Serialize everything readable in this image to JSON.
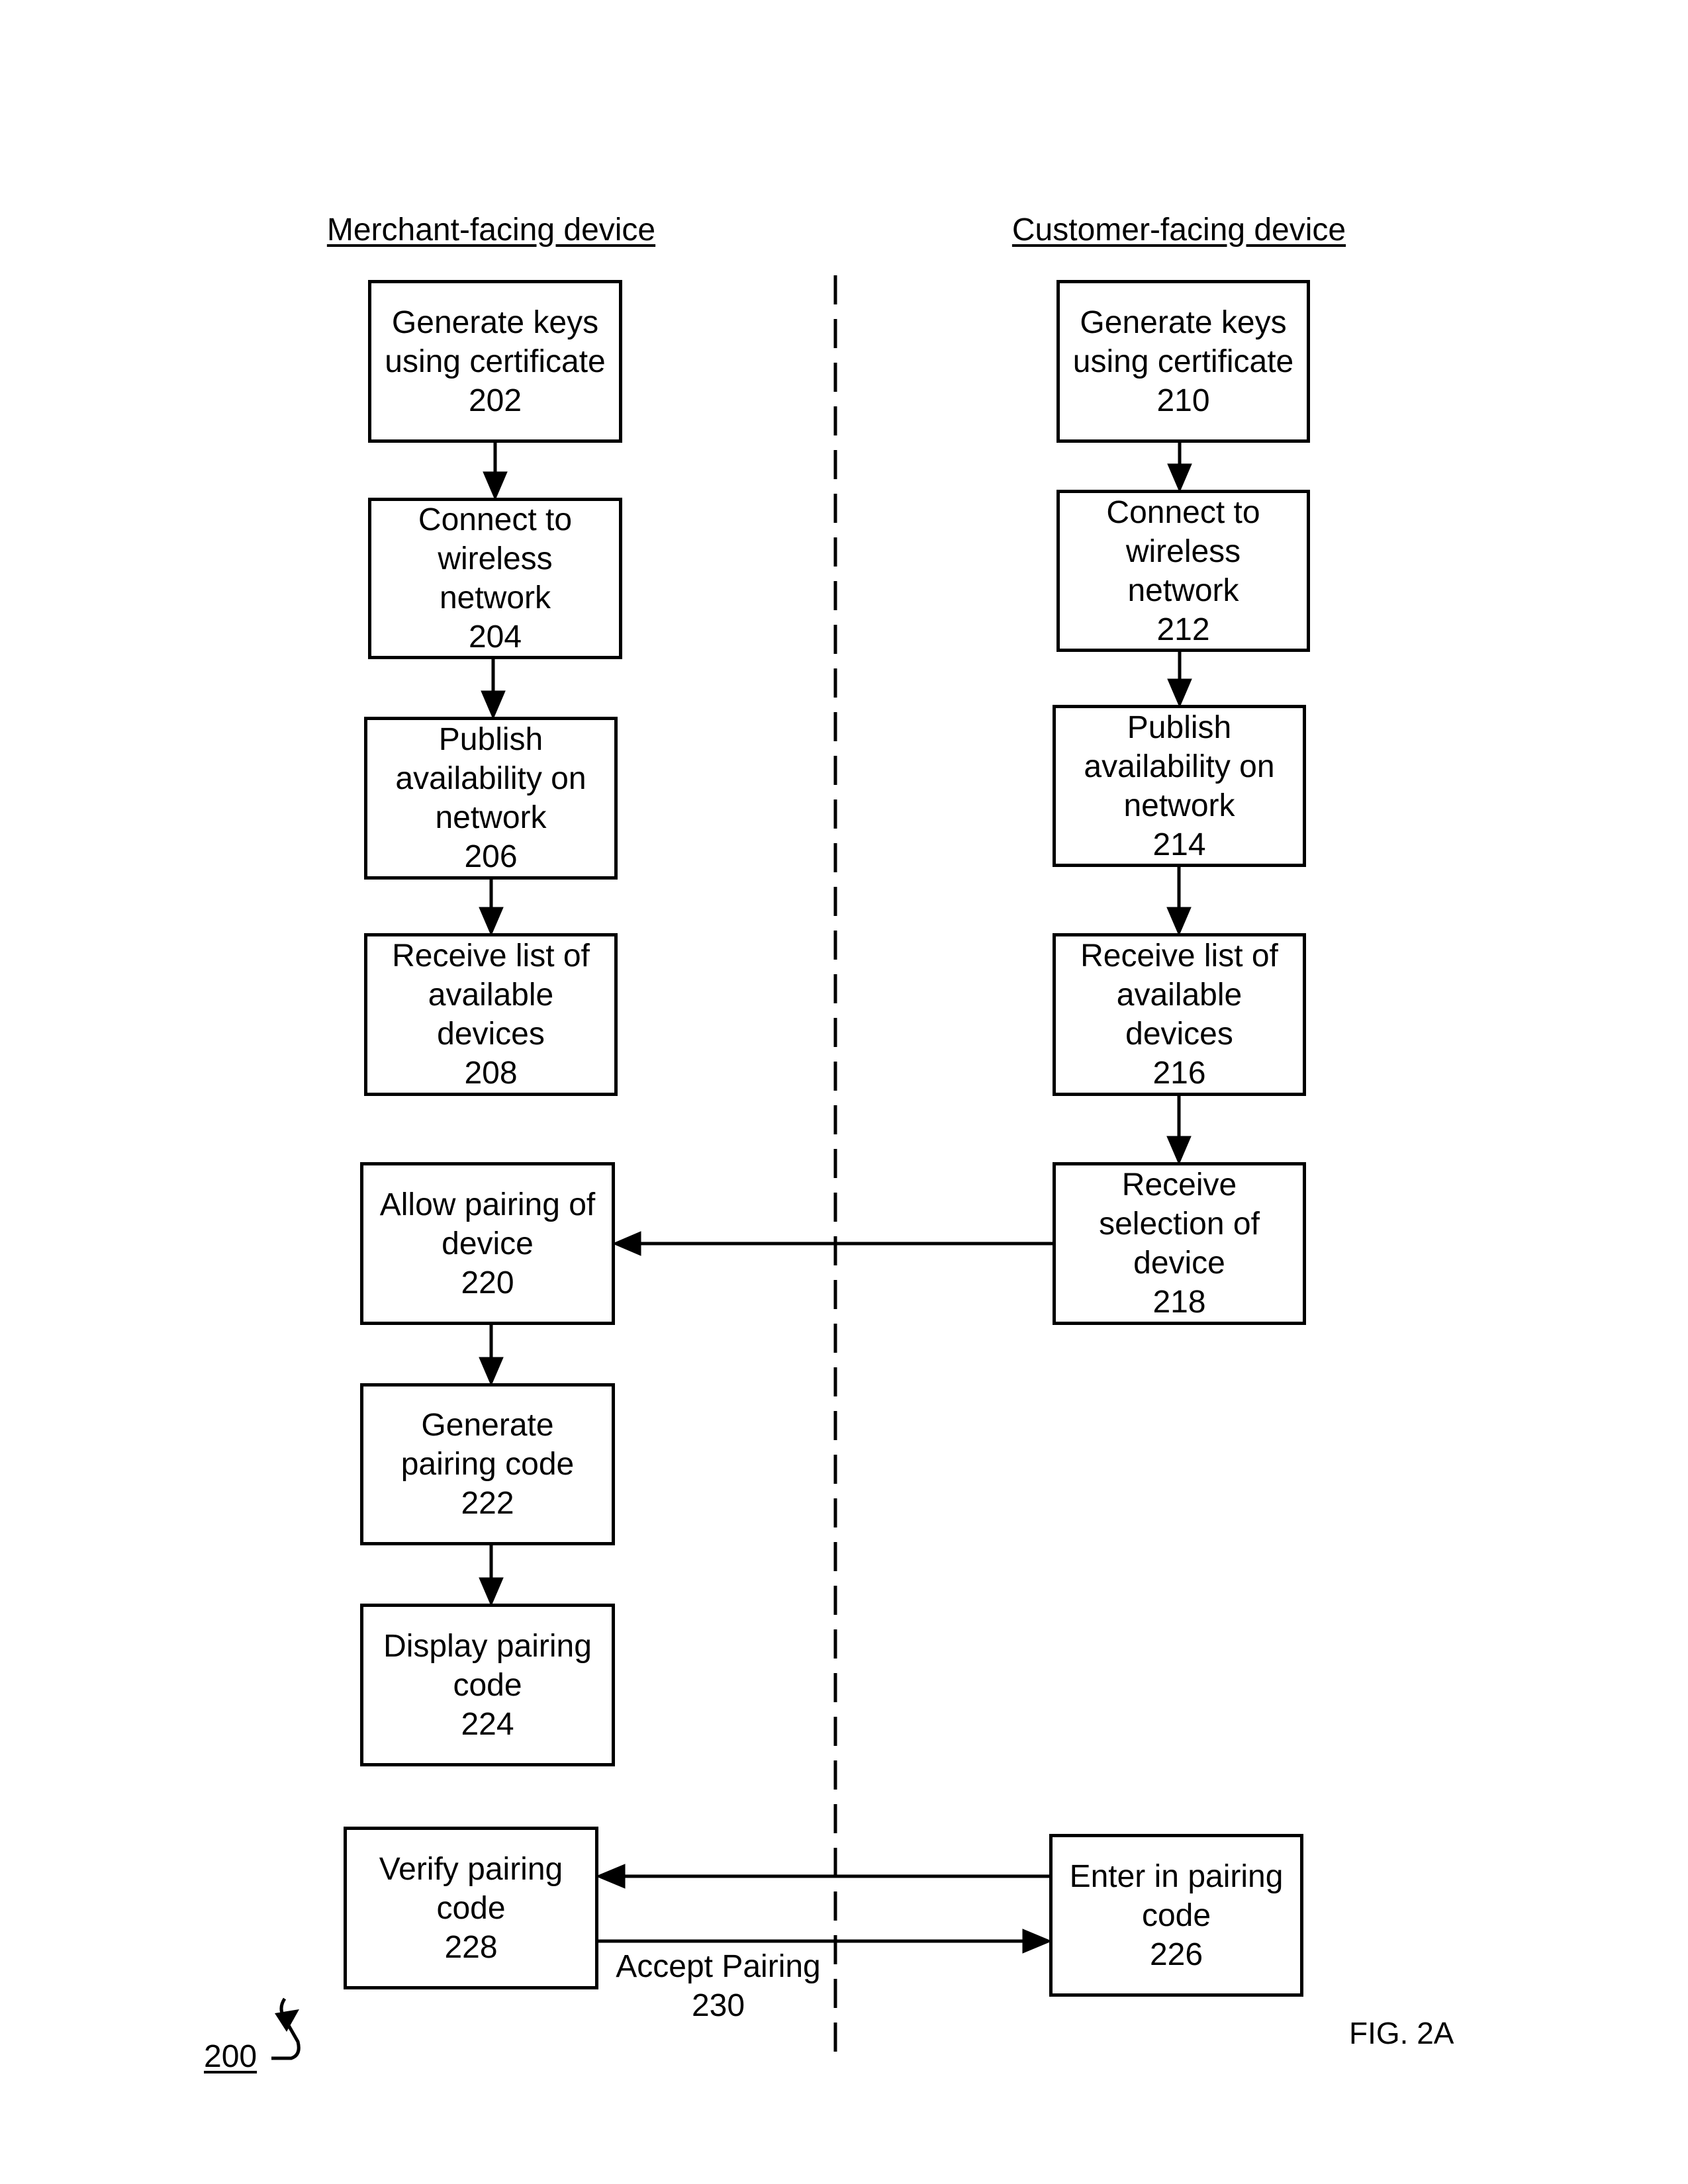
{
  "headers": {
    "merchant": "Merchant-facing device",
    "customer": "Customer-facing device"
  },
  "boxes": {
    "b202": {
      "lines": [
        "Generate keys",
        "using certificate"
      ],
      "ref": "202"
    },
    "b204": {
      "lines": [
        "Connect to",
        "wireless",
        "network"
      ],
      "ref": "204"
    },
    "b206": {
      "lines": [
        "Publish",
        "availability on",
        "network"
      ],
      "ref": "206"
    },
    "b208": {
      "lines": [
        "Receive list of",
        "available",
        "devices"
      ],
      "ref": "208"
    },
    "b220": {
      "lines": [
        "Allow pairing of",
        "device"
      ],
      "ref": "220"
    },
    "b222": {
      "lines": [
        "Generate",
        "pairing code"
      ],
      "ref": "222"
    },
    "b224": {
      "lines": [
        "Display pairing",
        "code"
      ],
      "ref": "224"
    },
    "b228": {
      "lines": [
        "Verify pairing",
        "code"
      ],
      "ref": "228"
    },
    "b210": {
      "lines": [
        "Generate keys",
        "using certificate"
      ],
      "ref": "210"
    },
    "b212": {
      "lines": [
        "Connect to",
        "wireless",
        "network"
      ],
      "ref": "212"
    },
    "b214": {
      "lines": [
        "Publish",
        "availability on",
        "network"
      ],
      "ref": "214"
    },
    "b216": {
      "lines": [
        "Receive list of",
        "available",
        "devices"
      ],
      "ref": "216"
    },
    "b218": {
      "lines": [
        "Receive",
        "selection of",
        "device"
      ],
      "ref": "218"
    },
    "b226": {
      "lines": [
        "Enter in pairing",
        "code"
      ],
      "ref": "226"
    }
  },
  "arrow_label": {
    "lines": [
      "Accept Pairing"
    ],
    "ref": "230"
  },
  "figure_ref": "200",
  "figure_label": "FIG. 2A"
}
